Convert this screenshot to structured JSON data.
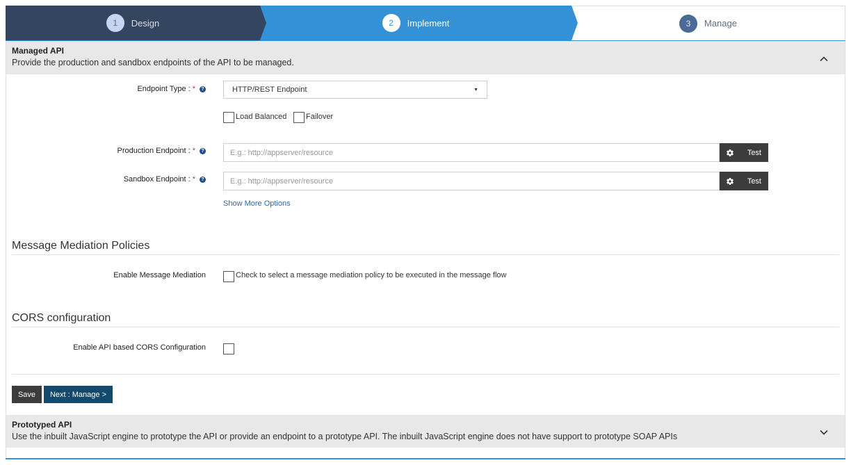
{
  "wizard": {
    "steps": [
      {
        "num": "1",
        "label": "Design"
      },
      {
        "num": "2",
        "label": "Implement"
      },
      {
        "num": "3",
        "label": "Manage"
      }
    ],
    "active_step": "2"
  },
  "managed_api": {
    "title": "Managed API",
    "description": "Provide the production and sandbox endpoints of the API to be managed.",
    "expanded": true,
    "endpoint_type": {
      "label": "Endpoint Type :",
      "required_mark": "*",
      "value": "HTTP/REST Endpoint"
    },
    "load_balanced_label": "Load Balanced",
    "failover_label": "Failover",
    "production_endpoint": {
      "label": "Production Endpoint :",
      "required_mark": "*",
      "placeholder": "E.g.: http://appserver/resource",
      "value": "",
      "test_label": "Test"
    },
    "sandbox_endpoint": {
      "label": "Sandbox Endpoint :",
      "required_mark": "*",
      "placeholder": "E.g.: http://appserver/resource",
      "value": "",
      "test_label": "Test"
    },
    "show_more_label": "Show More Options"
  },
  "mediation": {
    "title": "Message Mediation Policies",
    "enable_label": "Enable Message Mediation",
    "checkbox_text": "Check to select a message mediation policy to be executed in the message flow"
  },
  "cors": {
    "title": "CORS configuration",
    "enable_label": "Enable API based CORS Configuration"
  },
  "actions": {
    "save_label": "Save",
    "next_label": "Next : Manage >"
  },
  "prototyped_api": {
    "title": "Prototyped API",
    "description": "Use the inbuilt JavaScript engine to prototype the API or provide an endpoint to a prototype API. The inbuilt JavaScript engine does not have support to prototype SOAP APIs",
    "expanded": false
  },
  "icons": {
    "help": "question-circle-icon",
    "gear": "gear-icon",
    "collapse": "chevron-up-icon",
    "expand": "chevron-down-icon",
    "dropdown": "caret-down-icon"
  },
  "colors": {
    "step_done": "#34465f",
    "step_active": "#3591d6",
    "step_pending_badge": "#4a6a97",
    "primary_button": "#14496e",
    "dark_button": "#3c3c3c",
    "link": "#2a6cb0",
    "required": "#c0392b"
  }
}
